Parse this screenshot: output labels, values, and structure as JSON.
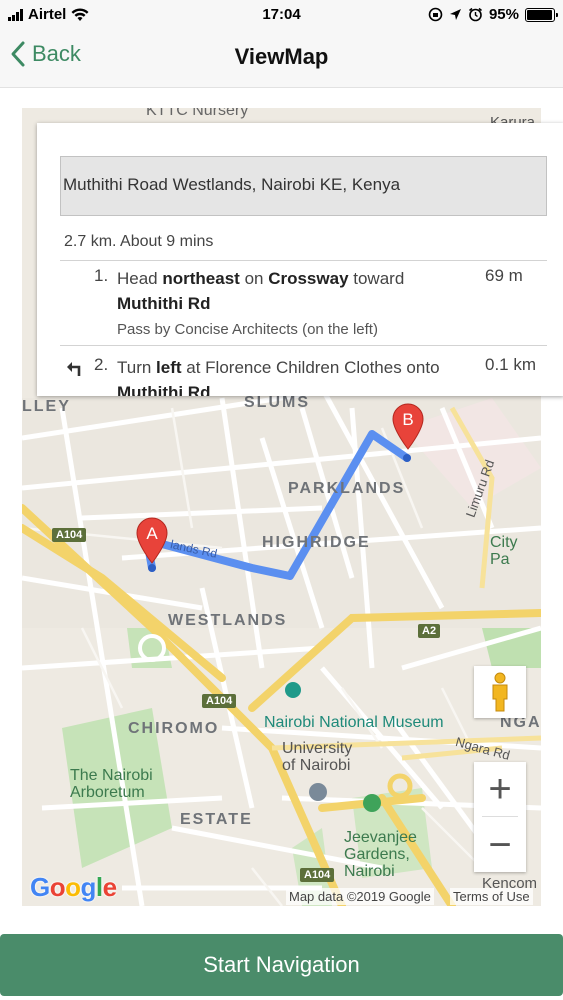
{
  "status_bar": {
    "carrier": "Airtel",
    "time": "17:04",
    "battery_percent": "95%",
    "battery_level": 0.95
  },
  "nav": {
    "back_label": "Back",
    "title": "ViewMap"
  },
  "directions": {
    "destination": "Muthithi Road Westlands, Nairobi KE, Kenya",
    "summary": "2.7 km. About 9 mins",
    "steps": [
      {
        "number": "1.",
        "pre": "Head ",
        "b1": "northeast",
        "mid": " on ",
        "b2": "Crossway",
        "post": " toward ",
        "b3": "Muthithi Rd",
        "sub": "Pass by Concise Architects (on the left)",
        "distance": "69 m"
      },
      {
        "number": "2.",
        "pre": "Turn ",
        "b1": "left",
        "mid": " at Florence Children Clothes onto ",
        "b2": "Muthithi Rd",
        "distance": "0.1 km"
      }
    ]
  },
  "map": {
    "areas": {
      "slums": "SLUMS",
      "parklands": "PARKLANDS",
      "highridge": "HIGHRIDGE",
      "westlands": "WESTLANDS",
      "chiromo": "CHIROMO",
      "estate": "ESTATE",
      "valley": "LLEY"
    },
    "places": {
      "nursery": "KTTC Nursery",
      "karura": "Karura",
      "city_park": "City Pa",
      "museum": "Nairobi National Museum",
      "university": "University\nof Nairobi",
      "arboretum": "The Nairobi\nArboretum",
      "jeevanjee": "Jeevanjee\nGardens,\nNairobi",
      "kencom": "Kencom",
      "ngara": "NGAR",
      "ngara_rd": "Ngara Rd",
      "limuru_rd": "Limuru Rd",
      "route_street": "lands Rd"
    },
    "shields": {
      "a104_top": "A104",
      "a104_mid": "A104",
      "a104_bottom": "A104",
      "a2": "A2"
    },
    "markers": {
      "start": "A",
      "end": "B"
    },
    "google": "Google",
    "map_data": "Map data ©2019 Google",
    "terms": "Terms of Use",
    "zoom_in": "+",
    "zoom_out": "−"
  },
  "start_button": "Start Navigation",
  "colors": {
    "accent": "#3d8a63",
    "button": "#4a8c6a",
    "route": "#5b8ff0",
    "marker": "#e8433a"
  },
  "icons": [
    "cellular-signal-icon",
    "wifi-icon",
    "location-arrow-icon",
    "alarm-icon",
    "battery-icon",
    "chevron-left-icon",
    "turn-left-icon",
    "pegman-icon"
  ]
}
